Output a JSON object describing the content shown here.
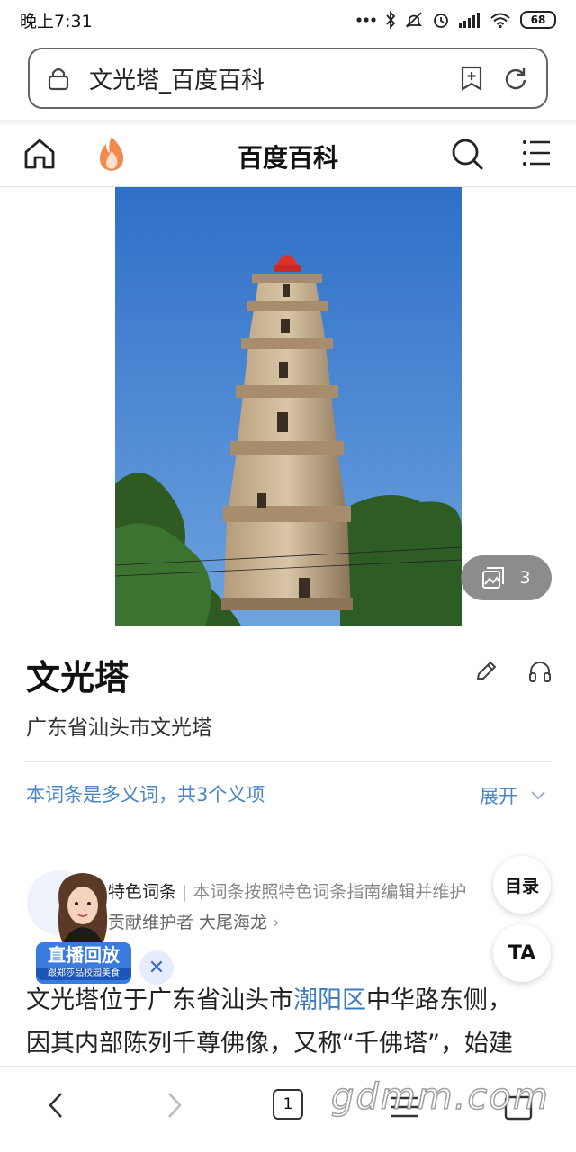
{
  "status_bar": {
    "time": "晚上7:31",
    "battery": "68",
    "icons": [
      "dots-icon",
      "bluetooth-icon",
      "mute-icon",
      "alarm-icon",
      "signal-icon",
      "wifi-icon",
      "battery-icon"
    ]
  },
  "browser": {
    "url_title": "文光塔_百度百科",
    "icons": [
      "lock-icon",
      "add-bookmark-icon",
      "refresh-icon"
    ]
  },
  "nav": {
    "title": "百度百科",
    "icons": [
      "home-icon",
      "flame-icon",
      "search-icon",
      "menu-icon"
    ]
  },
  "hero": {
    "photo_count": "3"
  },
  "entry": {
    "title": "文光塔",
    "subtitle": "广东省汕头市文光塔",
    "polysemy_text": "本词条是多义词，共3个义项",
    "expand_label": "展开",
    "feature_tag": "特色词条",
    "feature_desc": "本词条按照特色词条指南编辑并维护",
    "contributor": "贡献维护者 大尾海龙"
  },
  "live": {
    "banner_title": "直播回放",
    "banner_sub": "跟郑莎品校园美食",
    "close_symbol": "✕"
  },
  "float_buttons": {
    "toc": "目录",
    "font": "TA"
  },
  "body": {
    "line1_pre": "文光塔位于广东省汕头市",
    "line1_link": "潮阳区",
    "line1_post": "中华路东侧，",
    "line2": "因其内部陈列千尊佛像，又称“千佛塔”，始建"
  },
  "bottom_bar": {
    "tab_count": "1",
    "icons": [
      "back-icon",
      "forward-icon",
      "tabs-icon",
      "menu-icon",
      "home-icon"
    ]
  },
  "watermark": "gdmm.com"
}
